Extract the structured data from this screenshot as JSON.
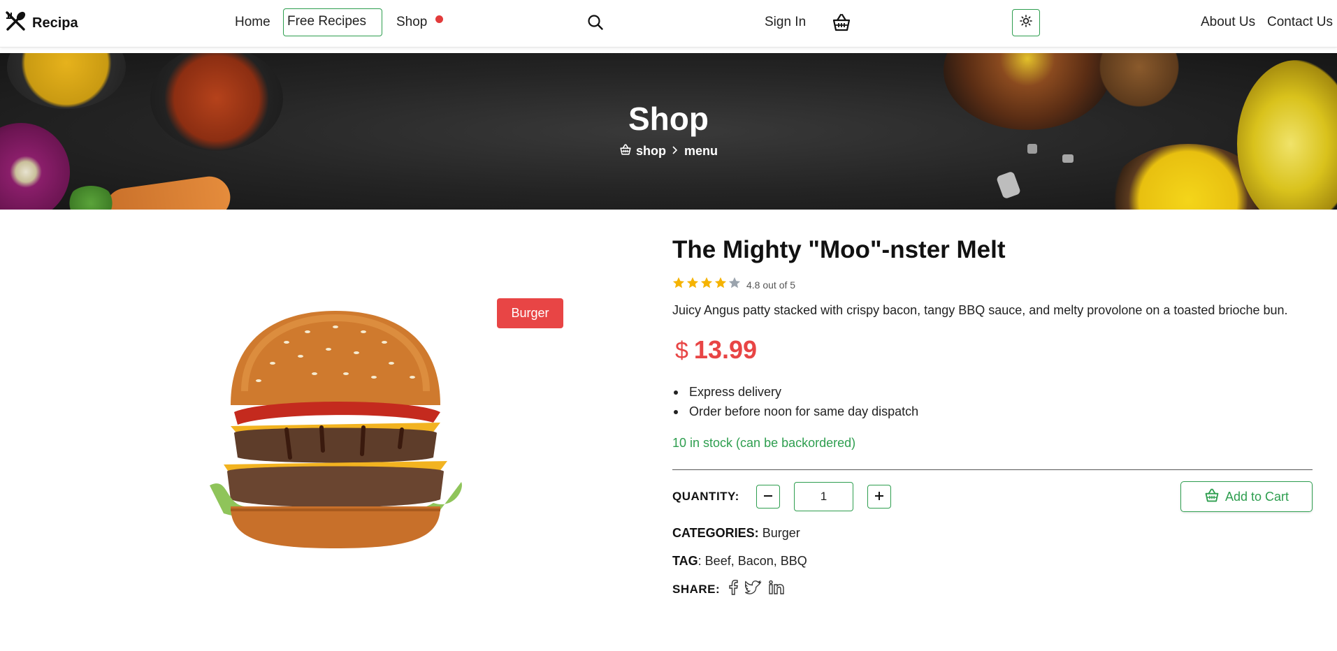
{
  "nav": {
    "brand": "Recipa",
    "home": "Home",
    "free_recipes": "Free Recipes",
    "shop": "Shop",
    "sign_in": "Sign In",
    "about": "About Us",
    "contact": "Contact Us"
  },
  "hero": {
    "title": "Shop",
    "breadcrumb": [
      "shop",
      "menu"
    ]
  },
  "product": {
    "badge": "Burger",
    "name": "The Mighty \"Moo\"-nster Melt",
    "rating": 4.8,
    "rating_text": "4.8 out of 5",
    "description": "Juicy Angus patty stacked with crispy bacon, tangy BBQ sauce, and melty provolone on a toasted brioche bun.",
    "currency": "$",
    "price": "13.99",
    "features": [
      "Express delivery",
      "Order before noon for same day dispatch"
    ],
    "stock": "10 in stock (can be backordered)",
    "quantity_label": "QUANTITY:",
    "quantity": "1",
    "add_to_cart": "Add to Cart",
    "categories_label": "CATEGORIES:",
    "categories": "Burger",
    "tag_label": "TAG",
    "tags": ": Beef, Bacon, BBQ",
    "share_label": "SHARE:"
  },
  "colors": {
    "accent_green": "#2e9e4f",
    "price_red": "#e84545",
    "star": "#f5b301"
  },
  "icons": [
    "fork-knife-icon",
    "search-icon",
    "basket-icon",
    "sun-icon",
    "star-icon",
    "minus-icon",
    "plus-icon",
    "facebook-icon",
    "twitter-icon",
    "linkedin-icon"
  ]
}
